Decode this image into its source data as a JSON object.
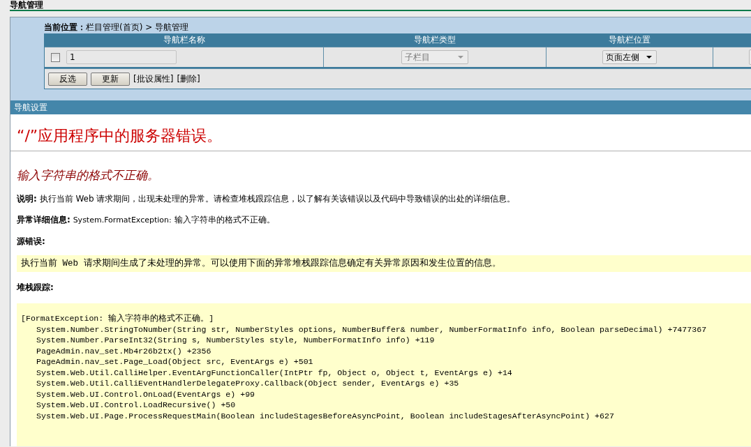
{
  "page_title": "导航管理",
  "breadcrumb": {
    "label": "当前位置：",
    "path": "栏目管理(首页) > 导航管理"
  },
  "table": {
    "columns": [
      "导航栏名称",
      "导航栏类型",
      "导航栏位置",
      ""
    ],
    "rows": [
      {
        "checked": false,
        "name": "1",
        "type": {
          "value": "子栏目",
          "disabled": true
        },
        "position": {
          "value": "页面左侧",
          "disabled": false
        }
      }
    ]
  },
  "actions": [
    {
      "kind": "button",
      "label": "反选"
    },
    {
      "kind": "button",
      "label": "更新"
    },
    {
      "kind": "link",
      "label": "[批设属性]"
    },
    {
      "kind": "link",
      "label": "[删除]"
    }
  ],
  "section_title": "导航设置",
  "error": {
    "title": "“/”应用程序中的服务器错误。",
    "message": "输入字符串的格式不正确。",
    "description_label": "说明:",
    "description": "执行当前 Web 请求期间，出现未处理的异常。请检查堆栈跟踪信息，以了解有关该错误以及代码中导致错误的出处的详细信息。",
    "details_label": "异常详细信息:",
    "details_type": "System.FormatException:",
    "details_text": "输入字符串的格式不正确。",
    "source_label": "源错误:",
    "source_text": "执行当前 Web 请求期间生成了未处理的异常。可以使用下面的异常堆栈跟踪信息确定有关异常原因和发生位置的信息。",
    "trace_label": "堆栈跟踪:",
    "trace_heading": "[FormatException: 输入字符串的格式不正确。]",
    "trace_frames": [
      "System.Number.StringToNumber(String str, NumberStyles options, NumberBuffer& number, NumberFormatInfo info, Boolean parseDecimal) +7477367",
      "System.Number.ParseInt32(String s, NumberStyles style, NumberFormatInfo info) +119",
      "PageAdmin.nav_set.Mb4r26b2tx() +2356",
      "PageAdmin.nav_set.Page_Load(Object src, EventArgs e) +501",
      "System.Web.Util.CalliHelper.EventArgFunctionCaller(IntPtr fp, Object o, Object t, EventArgs e) +14",
      "System.Web.Util.CalliEventHandlerDelegateProxy.Callback(Object sender, EventArgs e) +35",
      "System.Web.UI.Control.OnLoad(EventArgs e) +99",
      "System.Web.UI.Control.LoadRecursive() +50",
      "System.Web.UI.Page.ProcessRequestMain(Boolean includeStagesBeforeAsyncPoint, Boolean includeStagesAfterAsyncPoint) +627"
    ]
  }
}
